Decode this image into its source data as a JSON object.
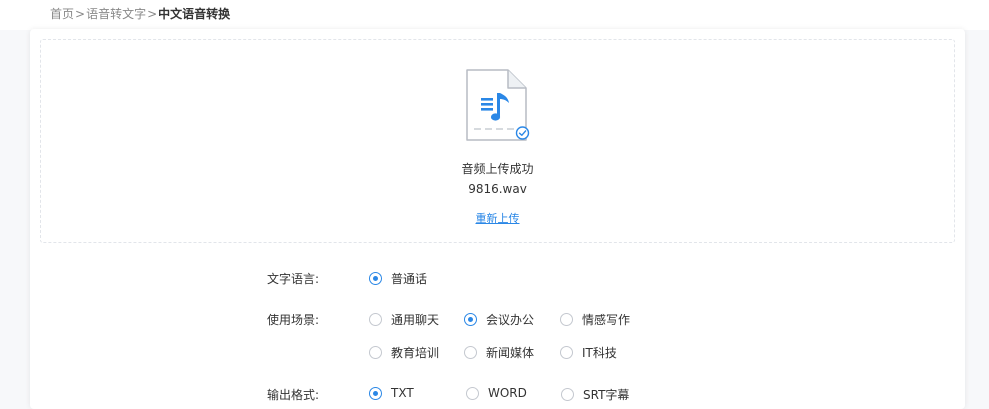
{
  "breadcrumb": {
    "home": "首页",
    "parent": "语音转文字",
    "current": "中文语音转换",
    "separator": ">"
  },
  "upload": {
    "status": "音频上传成功",
    "file_name": "9816.wav",
    "reupload_label": "重新上传",
    "file_icon": "audio-file-icon"
  },
  "form": {
    "language": {
      "label": "文字语言:",
      "options": [
        {
          "label": "普通话",
          "checked": true
        }
      ]
    },
    "scene": {
      "label": "使用场景:",
      "options": [
        {
          "label": "通用聊天",
          "checked": false
        },
        {
          "label": "会议办公",
          "checked": true
        },
        {
          "label": "情感写作",
          "checked": false
        },
        {
          "label": "教育培训",
          "checked": false
        },
        {
          "label": "新闻媒体",
          "checked": false
        },
        {
          "label": "IT科技",
          "checked": false
        }
      ]
    },
    "format": {
      "label": "输出格式:",
      "options": [
        {
          "label": "TXT",
          "checked": true
        },
        {
          "label": "WORD",
          "checked": false
        },
        {
          "label": "SRT字幕",
          "checked": false
        }
      ]
    }
  },
  "colors": {
    "accent": "#2a87e6",
    "background": "#f7f8fa",
    "card": "#ffffff",
    "text": "#333333",
    "muted": "#888888"
  }
}
